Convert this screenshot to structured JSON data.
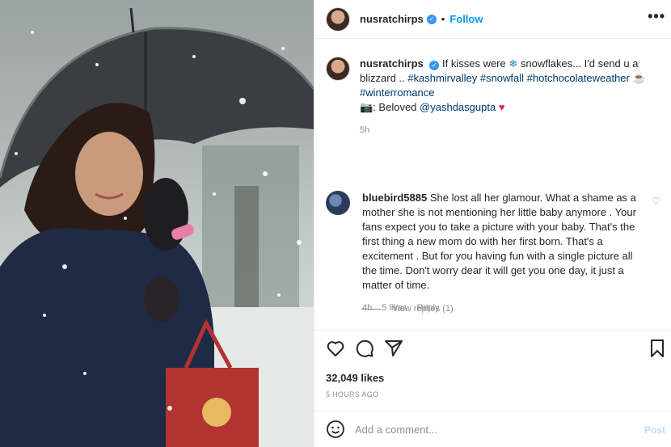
{
  "post": {
    "username": "nusratchirps",
    "follow_label": "Follow",
    "more_label": "•••"
  },
  "caption": {
    "username": "nusratchirps",
    "text_1": "If kisses were",
    "text_2": "snowflakes... I'd send u a blizzard ..",
    "tags": "#kashmirvalley #snowfall #hotchocolateweather",
    "tag_2": "#winterromance",
    "credit_prefix": "Beloved",
    "credit_user": "@yashdasgupta",
    "time": "5h"
  },
  "comment": {
    "username": "bluebird5885",
    "text": "She lost all her glamour. What a shame as a mother she is not mentioning her little baby anymore . Your fans expect you to take a picture with your baby. That's the first thing a new mom do with her first born. That's a excitement . But for you having fun with a single picture all the time. Don't worry dear it will get you one day, it just a matter of time.",
    "time": "4h",
    "likes": "5 likes",
    "reply_label": "Reply",
    "view_replies": "View replies (1)"
  },
  "stats": {
    "likes": "32,049 likes",
    "posted": "5 HOURS AGO"
  },
  "composer": {
    "placeholder": "Add a comment...",
    "post_label": "Post"
  },
  "colors": {
    "accent": "#0095f6",
    "post_disabled": "#b2dffc",
    "hashtag": "#00376b",
    "muted": "#8e8e8e"
  }
}
